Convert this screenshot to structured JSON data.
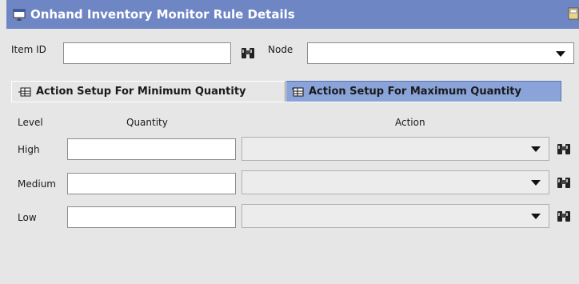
{
  "window": {
    "title": "Onhand Inventory Monitor Rule Details"
  },
  "filters": {
    "item_id_label": "Item ID",
    "item_id_value": "",
    "node_label": "Node",
    "node_value": ""
  },
  "tabs": [
    {
      "label": "Action Setup For Minimum Quantity",
      "active": true
    },
    {
      "label": "Action Setup For Maximum Quantity",
      "active": false
    }
  ],
  "grid": {
    "columns": {
      "level": "Level",
      "quantity": "Quantity",
      "action": "Action"
    },
    "rows": [
      {
        "level": "High",
        "quantity": "",
        "action": ""
      },
      {
        "level": "Medium",
        "quantity": "",
        "action": ""
      },
      {
        "level": "Low",
        "quantity": "",
        "action": ""
      }
    ]
  },
  "colors": {
    "title_bar": "#6f86c4",
    "inactive_tab": "#8aa3d9",
    "background": "#e6e6e6"
  },
  "icons": [
    "window-icon",
    "binoculars-icon",
    "tab-table-icon",
    "restore-icon"
  ]
}
